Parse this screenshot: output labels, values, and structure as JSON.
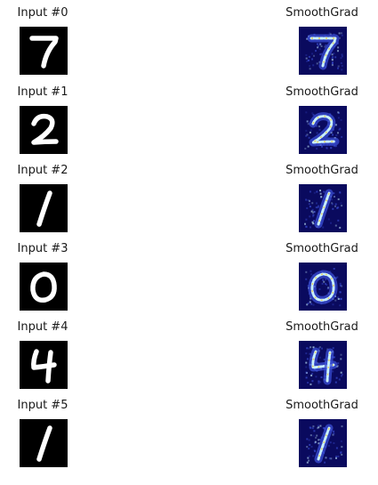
{
  "rows": [
    {
      "input_title": "Input #0",
      "map_title": "SmoothGrad",
      "digit": "7",
      "input_image": "digit-7-grayscale",
      "map_image": "digit-7-saliency-heatmap"
    },
    {
      "input_title": "Input #1",
      "map_title": "SmoothGrad",
      "digit": "2",
      "input_image": "digit-2-grayscale",
      "map_image": "digit-2-saliency-heatmap"
    },
    {
      "input_title": "Input #2",
      "map_title": "SmoothGrad",
      "digit": "1",
      "input_image": "digit-1-grayscale",
      "map_image": "digit-1-saliency-heatmap"
    },
    {
      "input_title": "Input #3",
      "map_title": "SmoothGrad",
      "digit": "0",
      "input_image": "digit-0-grayscale",
      "map_image": "digit-0-saliency-heatmap"
    },
    {
      "input_title": "Input #4",
      "map_title": "SmoothGrad",
      "digit": "4",
      "input_image": "digit-4-grayscale",
      "map_image": "digit-4-saliency-heatmap"
    },
    {
      "input_title": "Input #5",
      "map_title": "SmoothGrad",
      "digit": "1",
      "input_image": "digit-1-grayscale",
      "map_image": "digit-1-saliency-heatmap"
    }
  ],
  "colors": {
    "input_background": "#000000",
    "input_stroke": "#ffffff",
    "heatmap_background": "#0a0a5e",
    "heatmap_mid": "#3b4fd6",
    "heatmap_high": "#c8f0ff",
    "heatmap_hot": "#e8d060"
  }
}
